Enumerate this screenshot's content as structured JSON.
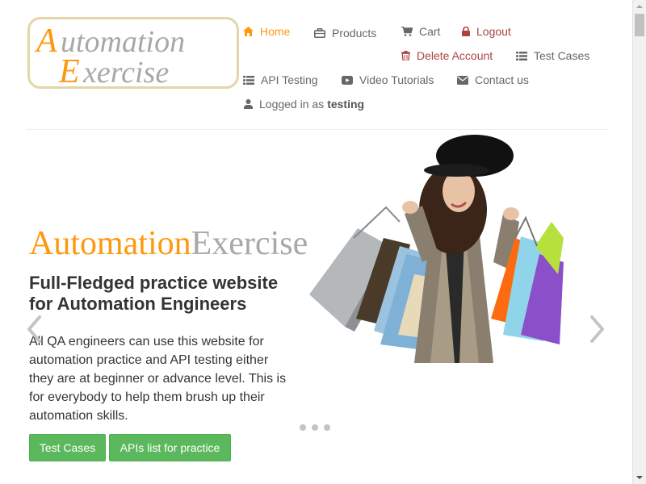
{
  "logo": {
    "line1_first": "A",
    "line1_rest": "utomation",
    "line2_first": "E",
    "line2_rest": "xercise"
  },
  "nav": {
    "home": "Home",
    "products": "Products",
    "cart": "Cart",
    "logout": "Logout",
    "delete_account": "Delete Account",
    "test_cases": "Test Cases",
    "api_testing": "API Testing",
    "video_tutorials": "Video Tutorials",
    "contact_us": "Contact us",
    "logged_in_prefix": "Logged in as",
    "username": "testing"
  },
  "hero": {
    "brand_part1": "Automation",
    "brand_part2": "Exercise",
    "title": "Full-Fledged practice website for Automation Engineers",
    "description": "All QA engineers can use this website for automation practice and API testing either they are at beginner or advance level. This is for everybody to help them brush up their automation skills.",
    "button_test_cases": "Test Cases",
    "button_apis": "APIs list for practice"
  },
  "colors": {
    "accent": "#fe980f",
    "danger": "#a94442",
    "button": "#5cb85c"
  },
  "icons": {
    "home": "home-icon",
    "products": "briefcase-icon",
    "cart": "cart-icon",
    "logout": "lock-icon",
    "delete": "trash-icon",
    "test_cases": "list-icon",
    "api_testing": "list-icon",
    "video": "youtube-play-icon",
    "contact": "envelope-icon",
    "user": "user-icon"
  }
}
